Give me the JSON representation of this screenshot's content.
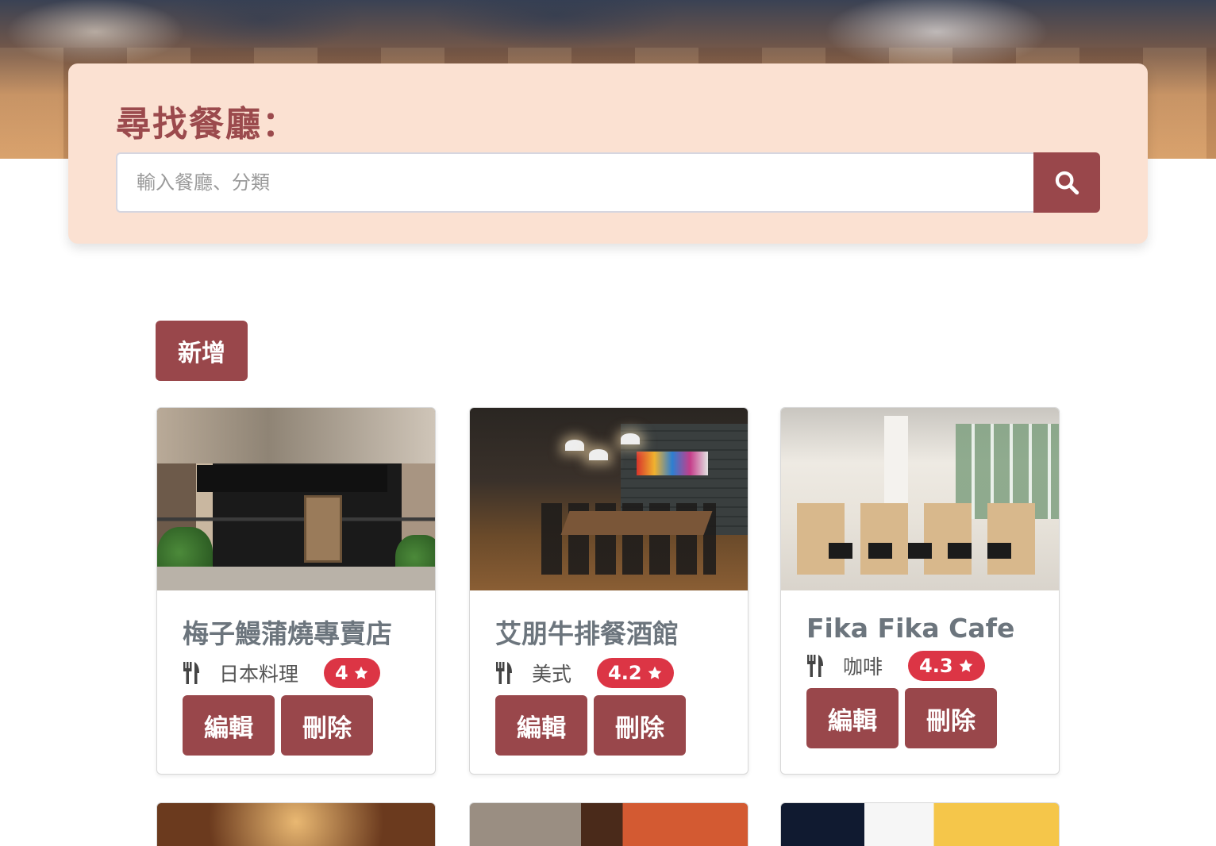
{
  "search": {
    "title": "尋找餐廳：",
    "placeholder": "輸入餐廳、分類",
    "value": ""
  },
  "actions": {
    "add_label": "新增"
  },
  "restaurants": [
    {
      "name": "梅子鰻蒲燒專賣店",
      "category": "日本料理",
      "rating": "4",
      "edit_label": "編輯",
      "delete_label": "刪除"
    },
    {
      "name": "艾朋牛排餐酒館",
      "category": "美式",
      "rating": "4.2",
      "edit_label": "編輯",
      "delete_label": "刪除"
    },
    {
      "name": "Fika Fika Cafe",
      "category": "咖啡",
      "rating": "4.3",
      "edit_label": "編輯",
      "delete_label": "刪除"
    }
  ],
  "icons": {
    "search": "search-icon",
    "utensils": "utensils-icon",
    "star": "star-icon"
  },
  "colors": {
    "primary": "#99474b",
    "panel": "#fbe1d2",
    "title": "#9b4a4d",
    "rating_badge": "#dc3545"
  }
}
